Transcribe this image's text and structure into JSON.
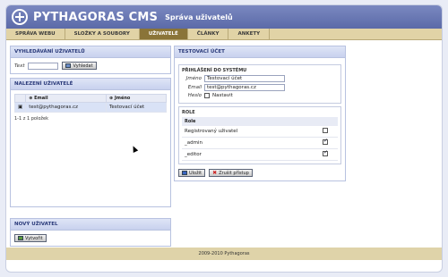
{
  "header": {
    "brand": "PYTHAGORAS CMS",
    "subtitle": "Správa uživatelů"
  },
  "tabs": [
    {
      "label": "SPRÁVA WEBU"
    },
    {
      "label": "SLOŽKY A SOUBORY"
    },
    {
      "label": "UŽIVATELÉ"
    },
    {
      "label": "ČLÁNKY"
    },
    {
      "label": "ANKETY"
    }
  ],
  "search": {
    "title": "VYHLEDÁVÁNÍ UŽIVATELŮ",
    "text_label": "Text",
    "text_value": "",
    "button": "Vyhledat"
  },
  "found": {
    "title": "NALEZENÍ UŽIVATELÉ",
    "columns": [
      "Email",
      "Jméno"
    ],
    "rows": [
      {
        "email": "test@pythagoras.cz",
        "name": "Testovací účet"
      }
    ],
    "pager": "1-1 z 1 položek"
  },
  "new_user": {
    "title": "NOVÝ UŽIVATEL",
    "button": "Vytvořit"
  },
  "account": {
    "title": "TESTOVACÍ ÚČET",
    "login_section": "PŘIHLÁŠENÍ DO SYSTÉMU",
    "name_label": "Jméno",
    "name_value": "Testovací účet",
    "email_label": "Email",
    "email_value": "test@pythagoras.cz",
    "password_label": "Heslo",
    "password_option": "Nastavit",
    "roles_section": "ROLE",
    "roles_header": "Role",
    "roles": [
      {
        "name": "Registrovaný uživatel",
        "checked": false
      },
      {
        "name": "_admin",
        "checked": true
      },
      {
        "name": "_editor",
        "checked": true
      }
    ],
    "save_button": "Uložit",
    "cancel_button": "Zrušit přístup"
  },
  "footer": "2009-2010 Pythagoras"
}
